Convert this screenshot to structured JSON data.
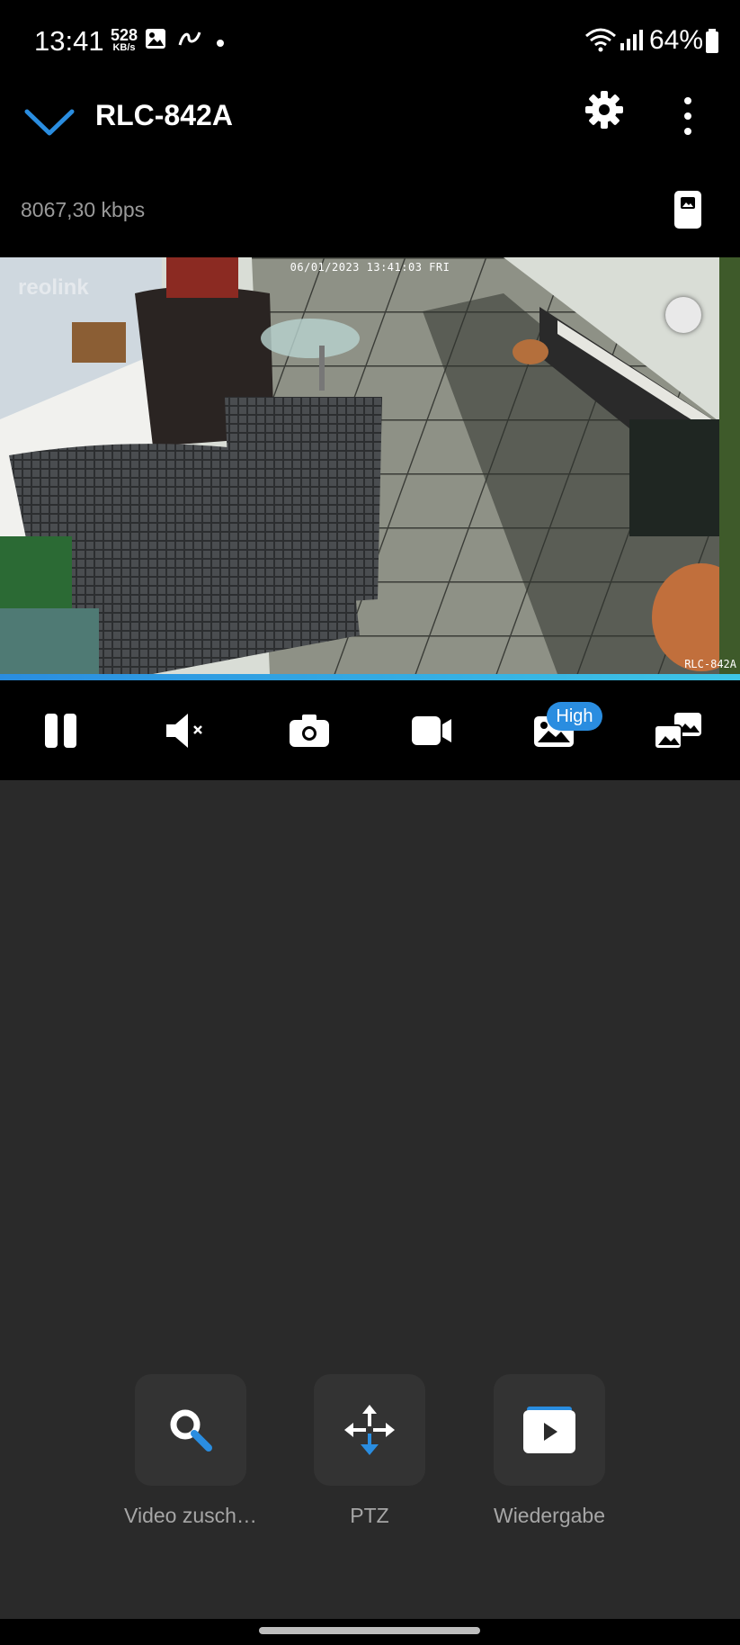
{
  "status_bar": {
    "time": "13:41",
    "net_speed_value": "528",
    "net_speed_unit": "KB/s",
    "battery_percent": "64%",
    "icons": [
      "gallery-icon",
      "s-app-icon",
      "dot-icon",
      "wifi-icon",
      "signal-icon",
      "battery-icon"
    ]
  },
  "app_bar": {
    "title": "RLC-842A",
    "back_icon": "chevron-down-icon",
    "settings_icon": "gear-icon",
    "more_icon": "more-vert-icon"
  },
  "stream": {
    "bitrate": "8067,30 kbps",
    "stream_icon": "mobile-stream-icon"
  },
  "video": {
    "timestamp": "06/01/2023 13:41:03 FRI",
    "camera_label": "RLC-842A",
    "watermark": "reolink"
  },
  "controls": {
    "items": [
      "pause-icon",
      "mute-icon",
      "snapshot-icon",
      "record-icon",
      "quality-icon",
      "multiview-icon"
    ],
    "quality_badge": "High"
  },
  "actions": [
    {
      "label": "Video zusch…",
      "icon": "search-icon"
    },
    {
      "label": "PTZ",
      "icon": "ptz-icon"
    },
    {
      "label": "Wiedergabe",
      "icon": "playback-icon"
    }
  ],
  "colors": {
    "accent": "#2a8de0",
    "background": "#2a2a2a",
    "bar": "#000000"
  }
}
